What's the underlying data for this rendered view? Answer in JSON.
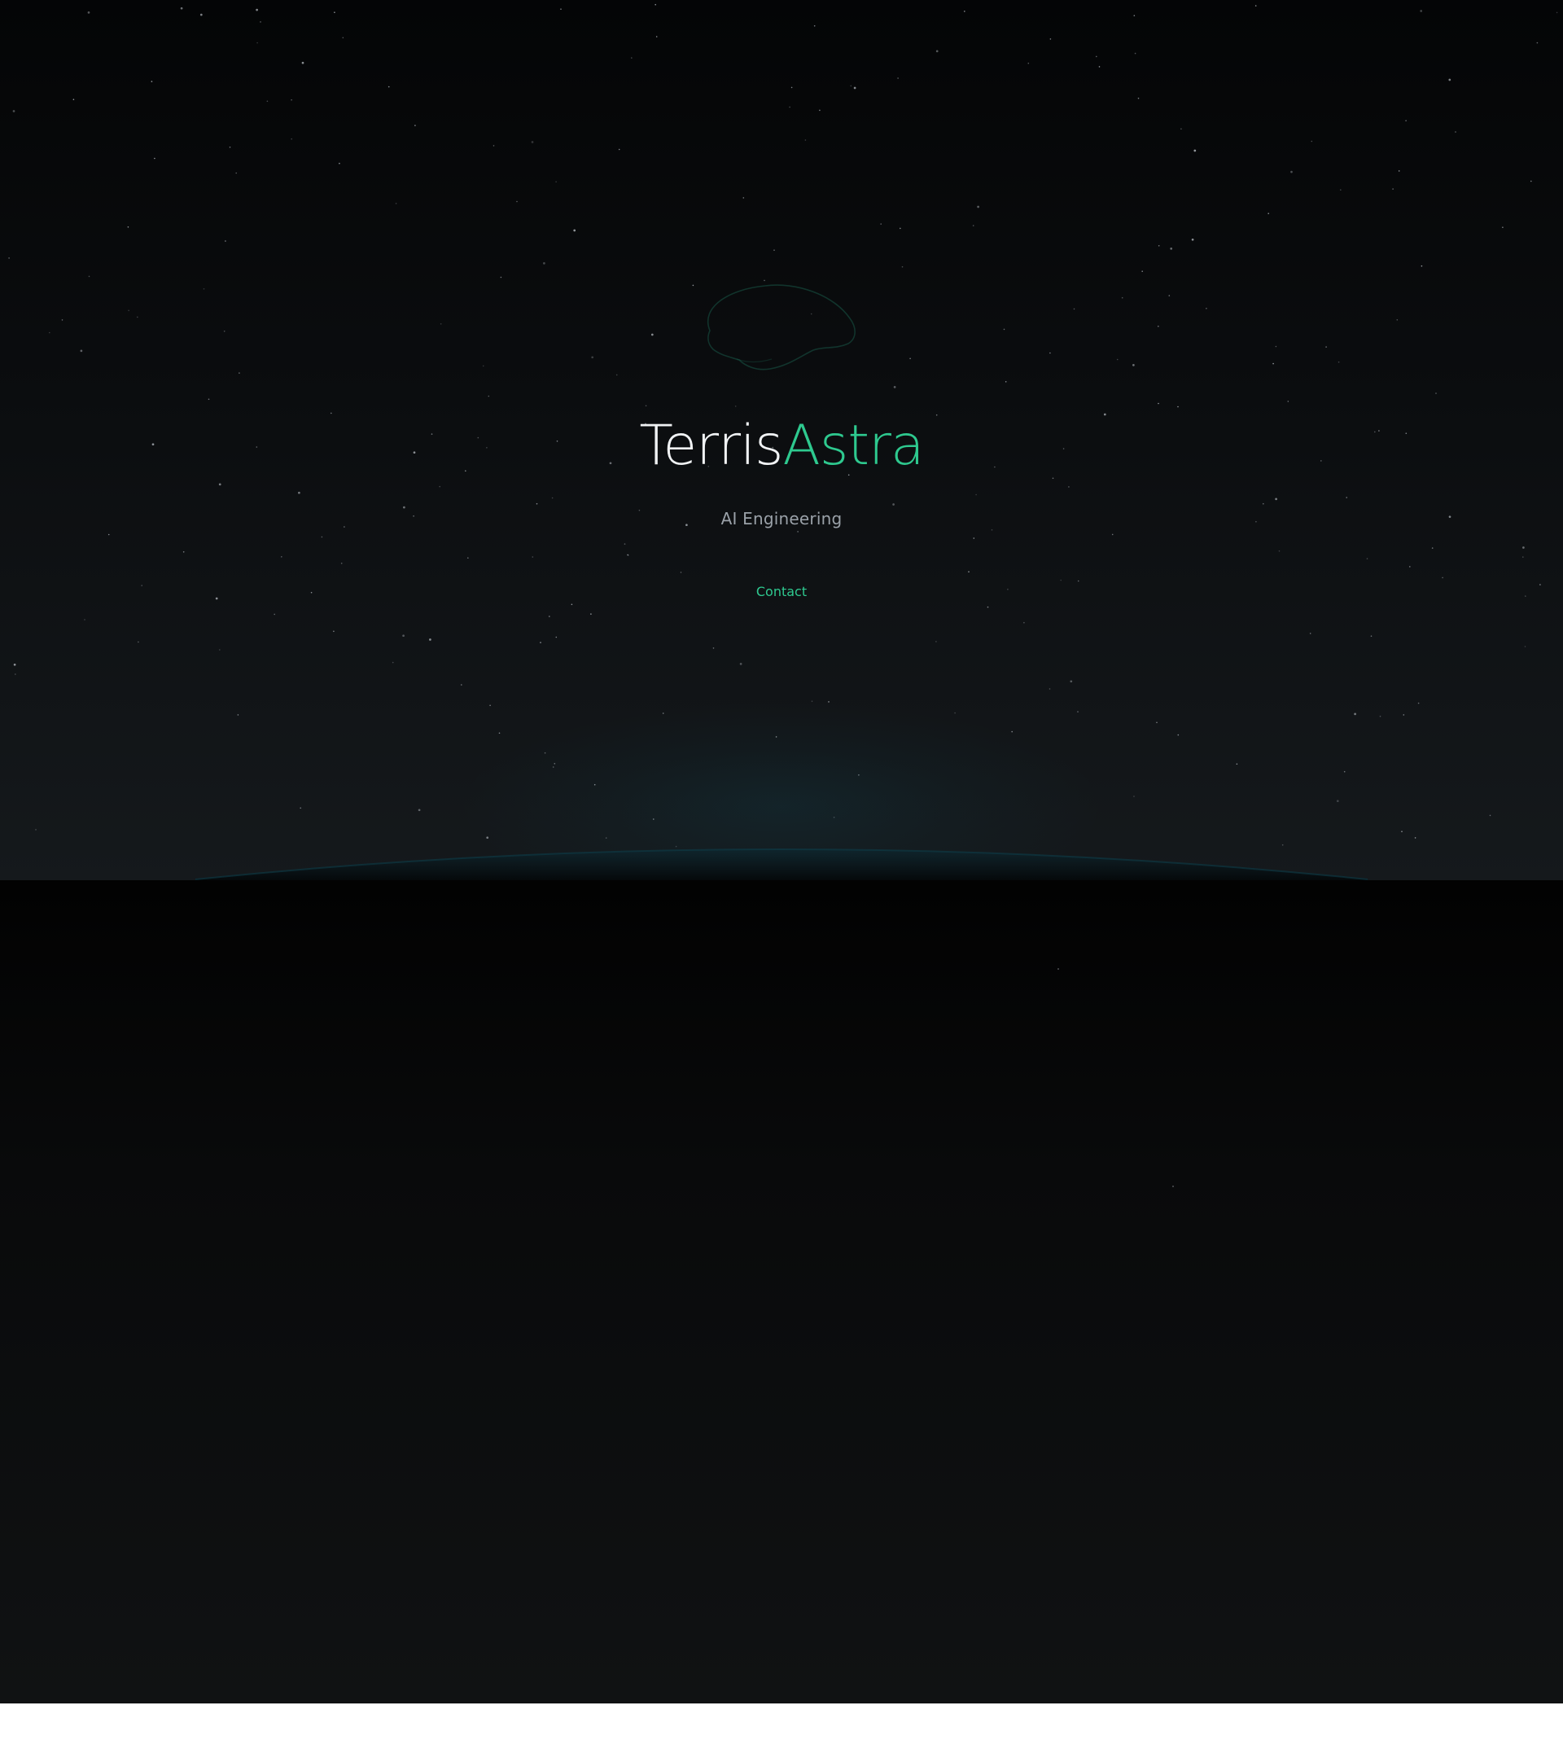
{
  "brand": {
    "primary": "Terris",
    "accent": "Astra"
  },
  "hero": {
    "subtitle": "AI Engineering",
    "contact_label": "Contact"
  },
  "colors": {
    "accent": "#2ec98f",
    "background_top": "#040506",
    "background_bottom": "#15191c",
    "text_primary": "#f0f2f4",
    "text_secondary": "#9aa1a8"
  },
  "icons": {
    "hero_icon": "brain-icon"
  }
}
